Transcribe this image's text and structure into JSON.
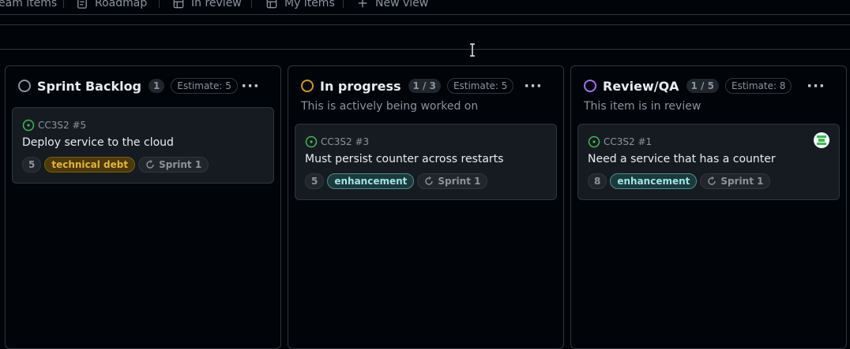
{
  "views": {
    "tabs": [
      {
        "label": "eam items",
        "icon": "table-icon"
      },
      {
        "label": "Roadmap",
        "icon": "roadmap-icon"
      },
      {
        "label": "In review",
        "icon": "table-icon"
      },
      {
        "label": "My items",
        "icon": "table-icon"
      },
      {
        "label": "New view",
        "icon": "plus-icon"
      }
    ]
  },
  "columns": [
    {
      "title": "Sprint Backlog",
      "count": "1",
      "estimate": "Estimate: 5",
      "description": "",
      "status_color": "#8b949e",
      "cards": [
        {
          "id": "CC3S2 #5",
          "title": "Deploy service to the cloud",
          "points": "5",
          "label": "technical debt",
          "label_kind": "debt",
          "iteration": "Sprint 1",
          "has_avatar": false
        }
      ]
    },
    {
      "title": "In progress",
      "count": "1 / 3",
      "estimate": "Estimate: 5",
      "description": "This is actively being worked on",
      "status_color": "#d29922",
      "cards": [
        {
          "id": "CC3S2 #3",
          "title": "Must persist counter across restarts",
          "points": "5",
          "label": "enhancement",
          "label_kind": "enhancement",
          "iteration": "Sprint 1",
          "has_avatar": false
        }
      ]
    },
    {
      "title": "Review/QA",
      "count": "1 / 5",
      "estimate": "Estimate: 8",
      "description": "This item is in review",
      "status_color": "#a371f7",
      "cards": [
        {
          "id": "CC3S2 #1",
          "title": "Need a service that has a counter",
          "points": "8",
          "label": "enhancement",
          "label_kind": "enhancement",
          "iteration": "Sprint 1",
          "has_avatar": true
        }
      ]
    }
  ],
  "colors": {
    "background": "#010409",
    "card": "#161b22",
    "border": "#30363d",
    "open_issue": "#3fb950"
  }
}
